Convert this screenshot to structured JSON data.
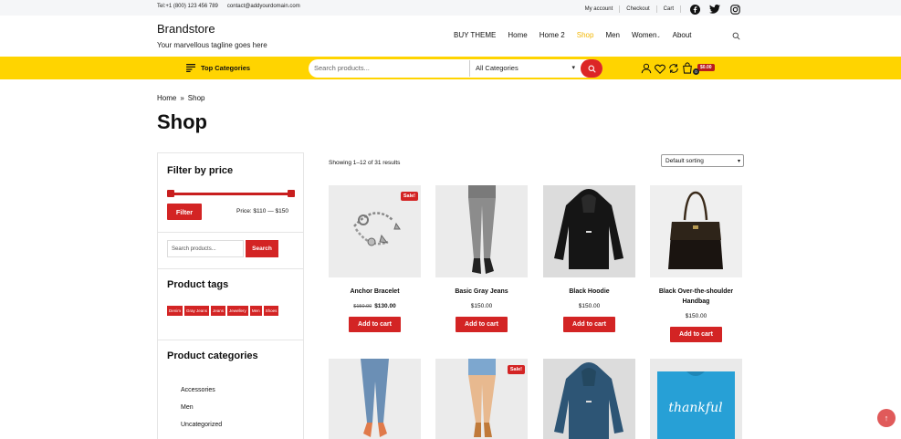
{
  "topbar": {
    "phone": "Tel:+1 (800) 123 456 789",
    "email": "contact@addyourdomain.com",
    "links": [
      "My account",
      "Checkout",
      "Cart"
    ]
  },
  "header": {
    "brand": "Brandstore",
    "tagline": "Your marvellous tagline goes here",
    "nav": [
      "BUY THEME",
      "Home",
      "Home 2",
      "Shop",
      "Men",
      "Women",
      "About"
    ],
    "active_nav": "Shop",
    "women_suffix": "⌄"
  },
  "searchbar": {
    "top_categories": "Top Categories",
    "placeholder": "Search products...",
    "category_select": "All Categories",
    "cart_total": "$0.00",
    "cart_count": "0"
  },
  "breadcrumb": {
    "home": "Home",
    "sep": "»",
    "current": "Shop"
  },
  "page_title": "Shop",
  "sidebar": {
    "filter_title": "Filter by price",
    "filter_button": "Filter",
    "price_label": "Price: $110 — $150",
    "search_placeholder": "Search products...",
    "search_button": "Search",
    "tags_title": "Product tags",
    "tags": [
      "Denim",
      "Gray Jeans",
      "Jeans",
      "Jewellery",
      "Men",
      "Shoes"
    ],
    "categories_title": "Product categories",
    "categories": [
      "Accessories",
      "Men",
      "Uncategorized"
    ]
  },
  "results": {
    "showing": "Showing 1–12 of 31 results",
    "sorting": "Default sorting"
  },
  "products": [
    {
      "name": "Anchor Bracelet",
      "old_price": "$150.00",
      "price": "$130.00",
      "sale": "Sale!",
      "button": "Add to cart"
    },
    {
      "name": "Basic Gray Jeans",
      "price": "$150.00",
      "button": "Add to cart"
    },
    {
      "name": "Black Hoodie",
      "price": "$150.00",
      "button": "Add to cart"
    },
    {
      "name": "Black Over-the-shoulder Handbag",
      "price": "$150.00",
      "button": "Add to cart"
    }
  ],
  "row2_sale": "Sale!",
  "tshirt_text": "thankful",
  "colors": {
    "accent_yellow": "#ffd400",
    "accent_red": "#d32424",
    "active_nav": "#f2b705"
  }
}
